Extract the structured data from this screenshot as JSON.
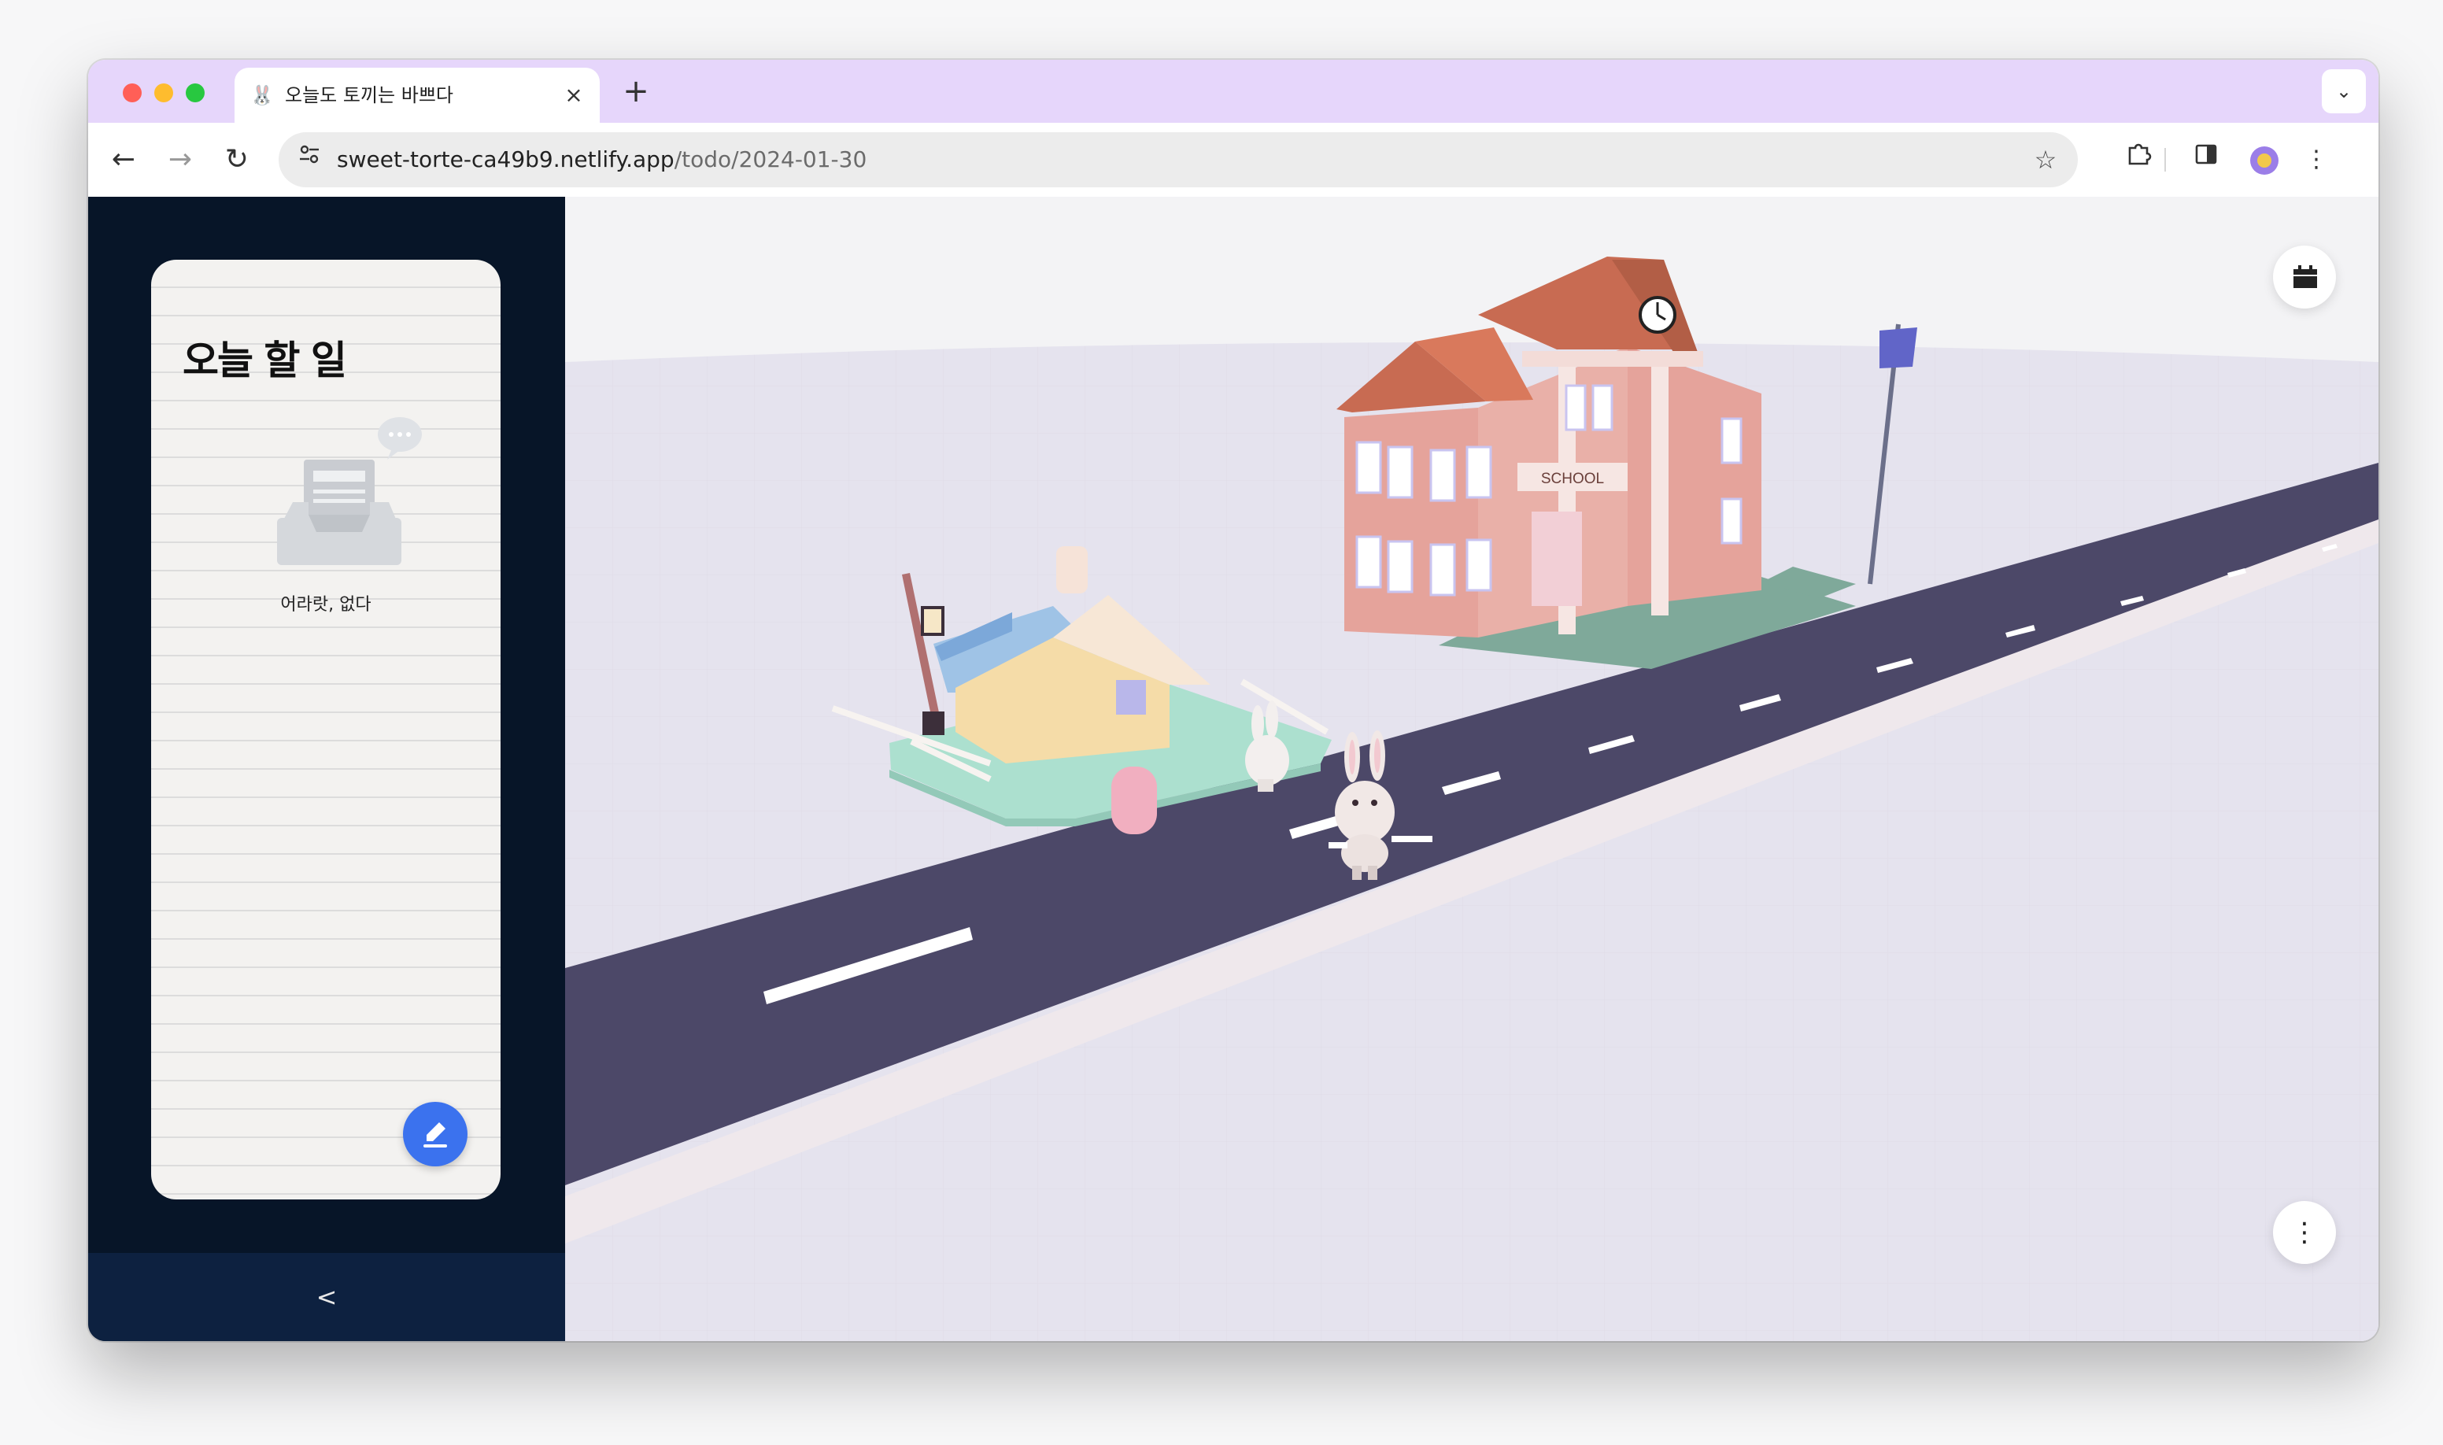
{
  "browser": {
    "tab": {
      "favicon": "rabbit-favicon",
      "title": "오늘도 토끼는 바쁘다"
    },
    "new_tab_label": "+",
    "url_host": "sweet-torte-ca49b9.netlify.app",
    "url_path": "/todo/2024-01-30",
    "icons": [
      "back-arrow-icon",
      "forward-arrow-icon",
      "reload-icon",
      "site-info-icon",
      "star-icon",
      "extensions-icon",
      "side-panel-icon",
      "profile-avatar",
      "kebab-menu-icon"
    ]
  },
  "sidebar": {
    "todo_title": "오늘 할 일",
    "empty_text": "어라랏, 없다",
    "write_button_icon": "pencil-icon",
    "collapse_label": "<"
  },
  "scene": {
    "sign_text": "SCHOOL",
    "calendar_button_icon": "calendar-icon",
    "more_button_label": "⋮",
    "colors": {
      "road": "#4c4868",
      "ground": "#e6e4ee",
      "school_wall": "#e5a39b",
      "school_roof": "#c86b52",
      "house_wall": "#f5dca8",
      "flag": "#6165c8",
      "fab_accent": "#3b72ee",
      "sidebar_bg": "#071528"
    }
  }
}
